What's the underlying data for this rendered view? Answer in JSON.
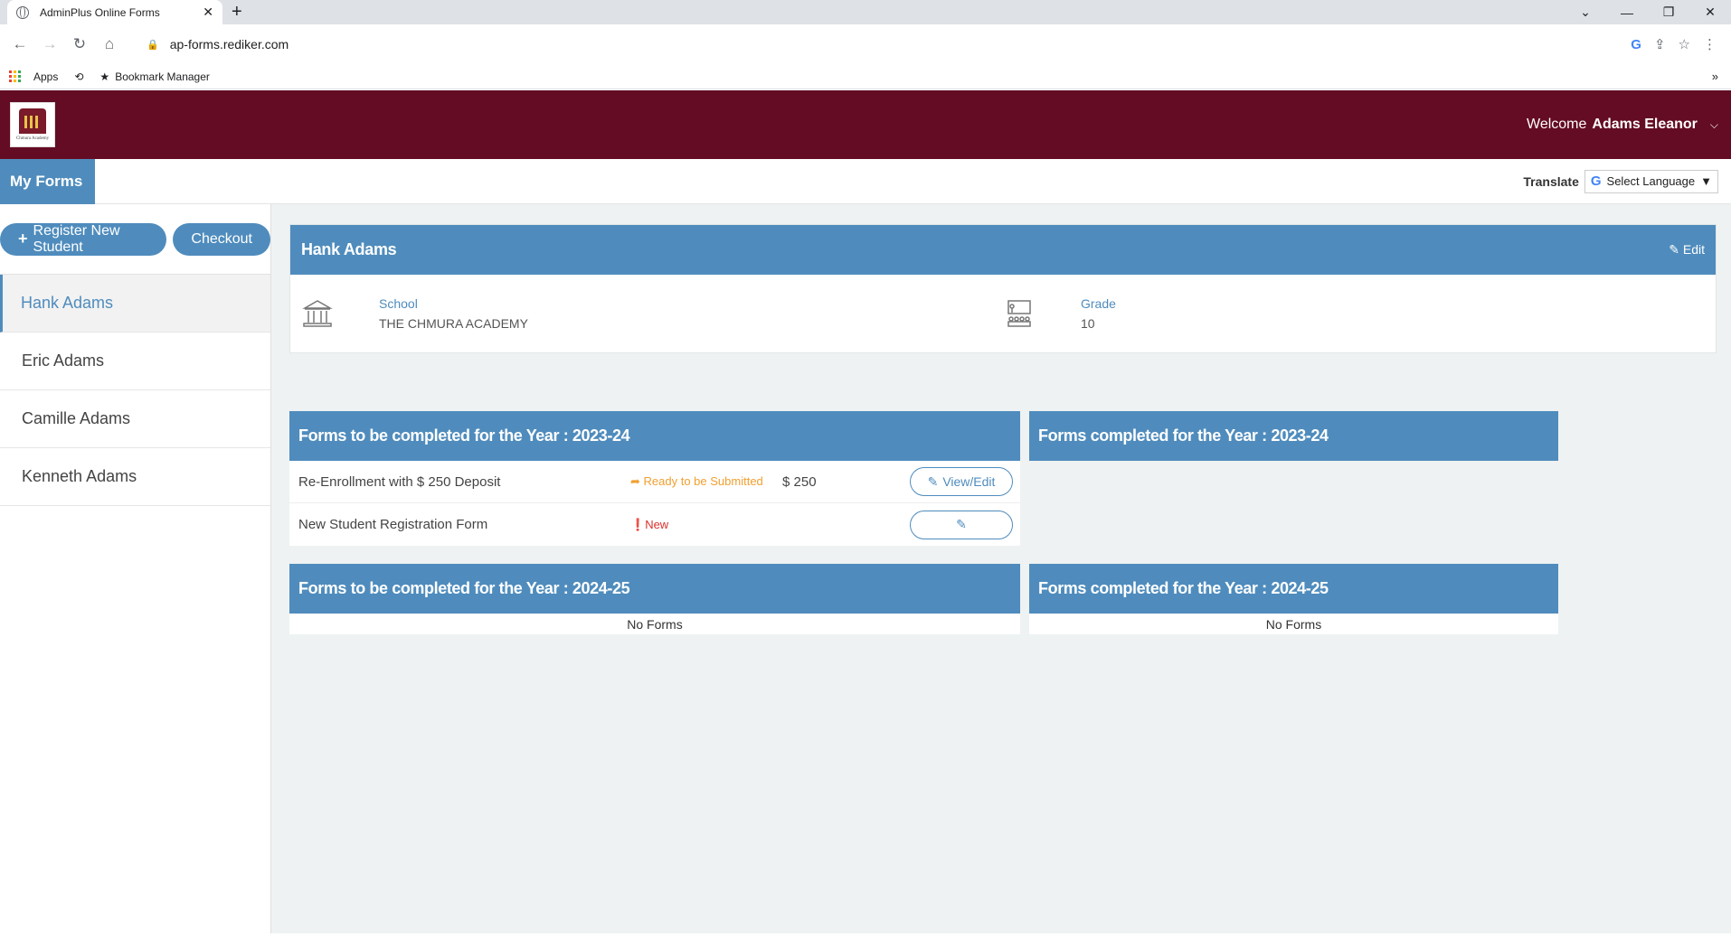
{
  "browser": {
    "tab_title": "AdminPlus Online Forms",
    "url": "ap-forms.rediker.com",
    "bookmarks": [
      "Apps",
      "Bookmark Manager"
    ]
  },
  "header": {
    "welcome_prefix": "Welcome",
    "user_name": "Adams Eleanor",
    "logo_text": "Chmura Academy"
  },
  "subbar": {
    "my_forms": "My Forms",
    "translate_label": "Translate",
    "language_select": "Select Language"
  },
  "sidebar": {
    "register_label": "Register New Student",
    "checkout_label": "Checkout",
    "students": [
      "Hank Adams",
      "Eric Adams",
      "Camille Adams",
      "Kenneth Adams"
    ],
    "active_index": 0
  },
  "student_card": {
    "name": "Hank Adams",
    "edit_label": "Edit",
    "school_label": "School",
    "school_value": "THE CHMURA ACADEMY",
    "grade_label": "Grade",
    "grade_value": "10"
  },
  "forms": {
    "todo_2023": "Forms to be completed for the Year : 2023-24",
    "done_2023": "Forms completed for the Year : 2023-24",
    "todo_2024": "Forms to be completed for the Year : 2024-25",
    "done_2024": "Forms completed for the Year : 2024-25",
    "rows": [
      {
        "name": "Re-Enrollment with $ 250 Deposit",
        "status": "Ready to be Submitted",
        "amount": "$ 250",
        "action": "View/Edit"
      },
      {
        "name": "New Student Registration Form",
        "status": "New",
        "amount": "",
        "action": ""
      }
    ],
    "no_forms": "No Forms"
  },
  "colors": {
    "brand_maroon": "#640c23",
    "accent_blue": "#4f8cbd",
    "status_ready": "#f0a030",
    "status_new": "#d9302c"
  }
}
